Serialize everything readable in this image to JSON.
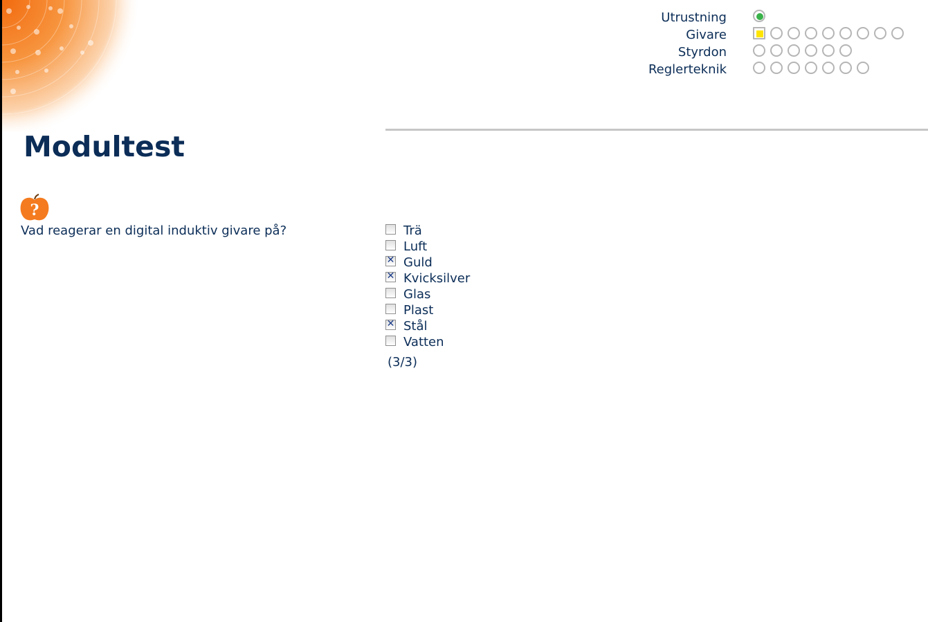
{
  "page": {
    "title": "Modultest"
  },
  "progress": {
    "rows": [
      {
        "label": "Utrustning",
        "states": [
          "done"
        ]
      },
      {
        "label": "Givare",
        "states": [
          "current",
          "todo",
          "todo",
          "todo",
          "todo",
          "todo",
          "todo",
          "todo",
          "todo"
        ]
      },
      {
        "label": "Styrdon",
        "states": [
          "todo",
          "todo",
          "todo",
          "todo",
          "todo",
          "todo"
        ]
      },
      {
        "label": "Reglerteknik",
        "states": [
          "todo",
          "todo",
          "todo",
          "todo",
          "todo",
          "todo",
          "todo"
        ]
      }
    ]
  },
  "quiz": {
    "icon": "question-apple-icon",
    "question": "Vad reagerar en digital induktiv givare på?",
    "options": [
      {
        "label": "Trä",
        "checked": false
      },
      {
        "label": "Luft",
        "checked": false
      },
      {
        "label": "Guld",
        "checked": true
      },
      {
        "label": "Kvicksilver",
        "checked": true
      },
      {
        "label": "Glas",
        "checked": false
      },
      {
        "label": "Plast",
        "checked": false
      },
      {
        "label": "Stål",
        "checked": true
      },
      {
        "label": "Vatten",
        "checked": false
      }
    ],
    "score": "(3/3)"
  },
  "colors": {
    "text": "#0b2d57",
    "accent_orange": "#f47b1f",
    "done_green": "#3ab24a",
    "current_yellow": "#ffe500",
    "dot_border": "#b5b5b5"
  }
}
